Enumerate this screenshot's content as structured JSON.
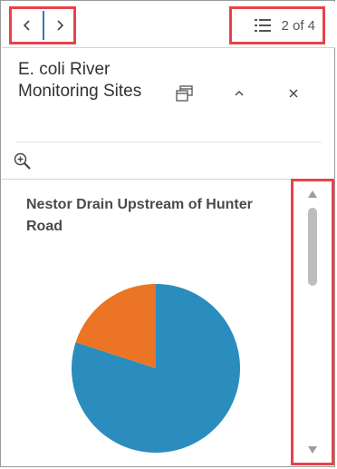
{
  "navigation": {
    "counter_text": "2 of 4"
  },
  "header": {
    "title": "E. coli River Monitoring Sites"
  },
  "icons": {
    "prev": "chevron-left-icon",
    "next": "chevron-right-icon",
    "list": "list-icon",
    "dock": "dock-icon",
    "collapse": "chevron-up-icon",
    "close": "close-icon",
    "zoom": "zoom-in-icon"
  },
  "colors": {
    "highlight": "#e8424a",
    "active": "#2e79b8",
    "pie_primary": "#2b8cbe",
    "pie_secondary": "#ec7425"
  },
  "content": {
    "chart_title": "Nestor Drain Upstream of Hunter Road"
  },
  "chart_data": {
    "type": "pie",
    "title": "Nestor Drain Upstream of Hunter Road",
    "values": [
      0.8,
      0.2
    ],
    "colors": [
      "#2b8cbe",
      "#ec7425"
    ]
  }
}
